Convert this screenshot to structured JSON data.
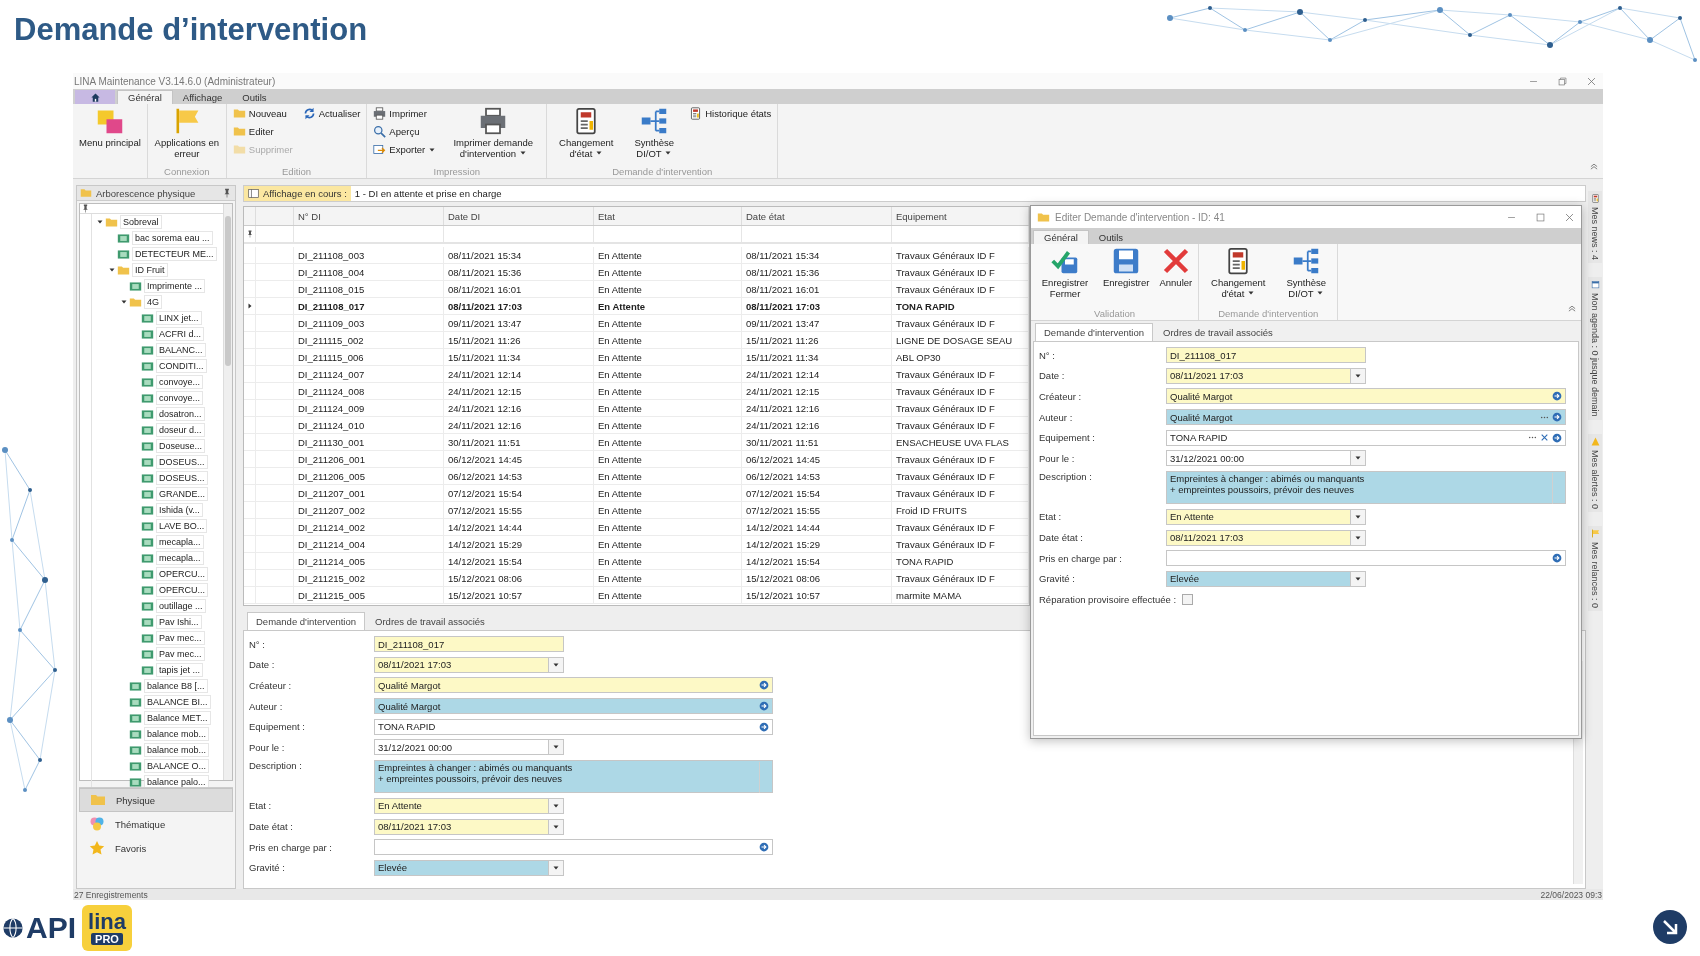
{
  "slide_title": "Demande d’intervention",
  "window": {
    "title": "LINA Maintenance V3.14.6.0 (Administrateur)"
  },
  "ribbon": {
    "tabs": [
      {
        "label": "Général",
        "selected": true
      },
      {
        "label": "Affichage",
        "selected": false
      },
      {
        "label": "Outils",
        "selected": false
      }
    ],
    "groups": [
      {
        "items": [
          {
            "label": "Menu principal",
            "kind": "large",
            "menu": false,
            "disabled": false
          }
        ]
      },
      {
        "label": "Connexion",
        "items": [
          {
            "label": "Applications en erreur",
            "kind": "large",
            "menu": false,
            "disabled": false
          }
        ]
      },
      {
        "label": "Edition",
        "items": [
          {
            "label": "Nouveau",
            "kind": "small",
            "menu": false,
            "disabled": false
          },
          {
            "label": "Editer",
            "kind": "small",
            "menu": false,
            "disabled": false
          },
          {
            "label": "Supprimer",
            "kind": "small",
            "menu": false,
            "disabled": true
          },
          {
            "label": "Actualiser",
            "kind": "small",
            "menu": false,
            "disabled": false
          }
        ]
      },
      {
        "label": "Impression",
        "items": [
          {
            "label": "Imprimer",
            "kind": "small",
            "menu": false,
            "disabled": false
          },
          {
            "label": "Aperçu",
            "kind": "small",
            "menu": false,
            "disabled": false
          },
          {
            "label": "Exporter",
            "kind": "small",
            "menu": true,
            "disabled": false
          },
          {
            "label": "Imprimer demande d'intervention",
            "kind": "large",
            "menu": true,
            "disabled": false
          }
        ]
      },
      {
        "label": "Demande d'intervention",
        "items": [
          {
            "label": "Changement d'état",
            "kind": "large",
            "menu": true,
            "disabled": false
          },
          {
            "label": "Synthèse DI/OT",
            "kind": "large",
            "menu": true,
            "disabled": false
          },
          {
            "label": "Historique états",
            "kind": "small",
            "menu": false,
            "disabled": false
          }
        ]
      }
    ]
  },
  "tree": {
    "title": "Arborescence physique",
    "items": [
      {
        "label": "Sobreval",
        "kind": "folder",
        "expanded": true,
        "children": [
          {
            "label": "bac sorema eau ...",
            "kind": "equipment"
          },
          {
            "label": "DETECTEUR ME...",
            "kind": "equipment"
          },
          {
            "label": "ID Fruit",
            "kind": "folder",
            "expanded": true,
            "children": [
              {
                "label": "Imprimente ...",
                "kind": "equipment"
              },
              {
                "label": "4G",
                "kind": "folder",
                "expanded": true,
                "children": [
                  {
                    "label": "LINX jet...",
                    "kind": "equipment"
                  },
                  {
                    "label": "ACFRI d...",
                    "kind": "equipment"
                  },
                  {
                    "label": "BALANC...",
                    "kind": "equipment"
                  },
                  {
                    "label": "CONDITI...",
                    "kind": "equipment"
                  },
                  {
                    "label": "convoye...",
                    "kind": "equipment"
                  },
                  {
                    "label": "convoye...",
                    "kind": "equipment"
                  },
                  {
                    "label": "dosatron...",
                    "kind": "equipment"
                  },
                  {
                    "label": "doseur d...",
                    "kind": "equipment"
                  },
                  {
                    "label": "Doseuse...",
                    "kind": "equipment"
                  },
                  {
                    "label": "DOSEUS...",
                    "kind": "equipment"
                  },
                  {
                    "label": "DOSEUS...",
                    "kind": "equipment"
                  },
                  {
                    "label": "GRANDE...",
                    "kind": "equipment"
                  },
                  {
                    "label": "Ishida (v...",
                    "kind": "equipment"
                  },
                  {
                    "label": "LAVE BO...",
                    "kind": "equipment"
                  },
                  {
                    "label": "mecapla...",
                    "kind": "equipment"
                  },
                  {
                    "label": "mecapla...",
                    "kind": "equipment"
                  },
                  {
                    "label": "OPERCU...",
                    "kind": "equipment"
                  },
                  {
                    "label": "OPERCU...",
                    "kind": "equipment"
                  },
                  {
                    "label": "outillage ...",
                    "kind": "equipment"
                  },
                  {
                    "label": "Pav Ishi...",
                    "kind": "equipment"
                  },
                  {
                    "label": "Pav mec...",
                    "kind": "equipment"
                  },
                  {
                    "label": "Pav mec...",
                    "kind": "equipment"
                  },
                  {
                    "label": "tapis jet ...",
                    "kind": "equipment"
                  }
                ]
              },
              {
                "label": "balance B8 [...",
                "kind": "equipment"
              },
              {
                "label": "BALANCE BI...",
                "kind": "equipment"
              },
              {
                "label": "Balance MET...",
                "kind": "equipment"
              },
              {
                "label": "balance mob...",
                "kind": "equipment"
              },
              {
                "label": "balance mob...",
                "kind": "equipment"
              },
              {
                "label": "BALANCE O...",
                "kind": "equipment"
              },
              {
                "label": "balance palo...",
                "kind": "equipment"
              }
            ]
          }
        ]
      }
    ]
  },
  "nav": [
    {
      "label": "Physique",
      "selected": true
    },
    {
      "label": "Thématique",
      "selected": false
    },
    {
      "label": "Favoris",
      "selected": false
    }
  ],
  "grid": {
    "view_label": "Affichage en cours :",
    "view_name": "1 - DI en attente et prise en charge",
    "columns": [
      "N° DI",
      "Date DI",
      "Etat",
      "Date état",
      "Equipement"
    ],
    "rows": [
      {
        "cells": [
          "DI_211108_003",
          "08/11/2021 15:34",
          "En Attente",
          "08/11/2021 15:34",
          "Travaux Généraux ID F"
        ],
        "selected": false
      },
      {
        "cells": [
          "DI_211108_004",
          "08/11/2021 15:36",
          "En Attente",
          "08/11/2021 15:36",
          "Travaux Généraux ID F"
        ],
        "selected": false
      },
      {
        "cells": [
          "DI_211108_015",
          "08/11/2021 16:01",
          "En Attente",
          "08/11/2021 16:01",
          "Travaux Généraux ID F"
        ],
        "selected": false
      },
      {
        "cells": [
          "DI_211108_017",
          "08/11/2021 17:03",
          "En Attente",
          "08/11/2021 17:03",
          "TONA RAPID"
        ],
        "selected": true
      },
      {
        "cells": [
          "DI_211109_003",
          "09/11/2021 13:47",
          "En Attente",
          "09/11/2021 13:47",
          "Travaux Généraux ID F"
        ],
        "selected": false
      },
      {
        "cells": [
          "DI_211115_002",
          "15/11/2021 11:26",
          "En Attente",
          "15/11/2021 11:26",
          "LIGNE DE DOSAGE SEAU"
        ],
        "selected": false
      },
      {
        "cells": [
          "DI_211115_006",
          "15/11/2021 11:34",
          "En Attente",
          "15/11/2021 11:34",
          "ABL OP30"
        ],
        "selected": false
      },
      {
        "cells": [
          "DI_211124_007",
          "24/11/2021 12:14",
          "En Attente",
          "24/11/2021 12:14",
          "Travaux Généraux ID F"
        ],
        "selected": false
      },
      {
        "cells": [
          "DI_211124_008",
          "24/11/2021 12:15",
          "En Attente",
          "24/11/2021 12:15",
          "Travaux Généraux ID F"
        ],
        "selected": false
      },
      {
        "cells": [
          "DI_211124_009",
          "24/11/2021 12:16",
          "En Attente",
          "24/11/2021 12:16",
          "Travaux Généraux ID F"
        ],
        "selected": false
      },
      {
        "cells": [
          "DI_211124_010",
          "24/11/2021 12:16",
          "En Attente",
          "24/11/2021 12:16",
          "Travaux Généraux ID F"
        ],
        "selected": false
      },
      {
        "cells": [
          "DI_211130_001",
          "30/11/2021 11:51",
          "En Attente",
          "30/11/2021 11:51",
          "ENSACHEUSE UVA FLAS"
        ],
        "selected": false
      },
      {
        "cells": [
          "DI_211206_001",
          "06/12/2021 14:45",
          "En Attente",
          "06/12/2021 14:45",
          "Travaux Généraux ID F"
        ],
        "selected": false
      },
      {
        "cells": [
          "DI_211206_005",
          "06/12/2021 14:53",
          "En Attente",
          "06/12/2021 14:53",
          "Travaux Généraux ID F"
        ],
        "selected": false
      },
      {
        "cells": [
          "DI_211207_001",
          "07/12/2021 15:54",
          "En Attente",
          "07/12/2021 15:54",
          "Travaux Généraux ID F"
        ],
        "selected": false
      },
      {
        "cells": [
          "DI_211207_002",
          "07/12/2021 15:55",
          "En Attente",
          "07/12/2021 15:55",
          "Froid ID FRUITS"
        ],
        "selected": false
      },
      {
        "cells": [
          "DI_211214_002",
          "14/12/2021 14:44",
          "En Attente",
          "14/12/2021 14:44",
          "Travaux Généraux ID F"
        ],
        "selected": false
      },
      {
        "cells": [
          "DI_211214_004",
          "14/12/2021 15:29",
          "En Attente",
          "14/12/2021 15:29",
          "Travaux Généraux ID F"
        ],
        "selected": false
      },
      {
        "cells": [
          "DI_211214_005",
          "14/12/2021 15:54",
          "En Attente",
          "14/12/2021 15:54",
          "TONA RAPID"
        ],
        "selected": false
      },
      {
        "cells": [
          "DI_211215_002",
          "15/12/2021 08:06",
          "En Attente",
          "15/12/2021 08:06",
          "Travaux Généraux ID F"
        ],
        "selected": false
      },
      {
        "cells": [
          "DI_211215_005",
          "15/12/2021 10:57",
          "En Attente",
          "15/12/2021 10:57",
          "marmite MAMA"
        ],
        "selected": false
      }
    ]
  },
  "detail": {
    "tabs": [
      {
        "label": "Demande d'intervention",
        "selected": true
      },
      {
        "label": "Ordres de travail associés",
        "selected": false
      }
    ],
    "fields": [
      {
        "label": "N° :",
        "kind": "text",
        "value": "DI_211108_017",
        "color": "#fdf9c6"
      },
      {
        "label": "Date :",
        "kind": "date",
        "value": "08/11/2021 17:03",
        "color": "#fdf9c6"
      },
      {
        "label": "Créateur :",
        "kind": "lookup",
        "value": "Qualité Margot",
        "color": "#fdf9c6",
        "buttons": [
          {
            "kind": "go"
          }
        ]
      },
      {
        "label": "Auteur :",
        "kind": "lookup",
        "value": "Qualité Margot",
        "color": "#add8e6",
        "buttons": [
          {
            "kind": "go"
          }
        ]
      },
      {
        "label": "Equipement :",
        "kind": "lookup",
        "value": "TONA RAPID",
        "color": "#ffffff",
        "buttons": [
          {
            "kind": "go"
          }
        ]
      },
      {
        "label": "Pour le :",
        "kind": "date",
        "value": "31/12/2021 00:00",
        "color": "#ffffff"
      },
      {
        "label": "Description :",
        "kind": "memo",
        "value": "Empreintes à changer : abimés ou manquants\n+ empreintes poussoirs, prévoir des neuves",
        "color": "#add8e6"
      },
      {
        "label": "Etat :",
        "kind": "combo",
        "value": "En Attente",
        "color": "#fdf9c6"
      },
      {
        "label": "Date état :",
        "kind": "date",
        "value": "08/11/2021 17:03",
        "color": "#fdf9c6"
      },
      {
        "label": "Pris en charge par :",
        "kind": "lookup",
        "color": "#ffffff",
        "buttons": [
          {
            "kind": "go"
          }
        ]
      },
      {
        "label": "Gravité :",
        "kind": "combo",
        "value": "Elevée",
        "color": "#add8e6"
      }
    ]
  },
  "side_tabs": [
    {
      "label": "Mes news : 4"
    },
    {
      "label": "Mon agenda : 0 jusque demain"
    },
    {
      "label": "Mes alertes : 0"
    },
    {
      "label": "Mes relances : 0"
    }
  ],
  "status_bar": {
    "left": "27 Enregistrements",
    "right": "22/06/2023 09:3"
  },
  "dialog": {
    "title": "Editer Demande d'intervention - ID: 41",
    "ribbon": {
      "tabs": [
        {
          "label": "Général",
          "selected": true
        },
        {
          "label": "Outils",
          "selected": false
        }
      ],
      "groups": [
        {
          "label": "Validation",
          "items": [
            {
              "label": "Enregistrer Fermer",
              "kind": "large",
              "menu": false,
              "disabled": false
            },
            {
              "label": "Enregistrer",
              "kind": "large",
              "menu": false,
              "disabled": false
            },
            {
              "label": "Annuler",
              "kind": "large",
              "menu": false,
              "disabled": false
            }
          ]
        },
        {
          "label": "Demande d'intervention",
          "items": [
            {
              "label": "Changement d'état",
              "kind": "large",
              "menu": true,
              "disabled": false
            },
            {
              "label": "Synthèse DI/OT",
              "kind": "large",
              "menu": true,
              "disabled": false
            }
          ]
        }
      ]
    },
    "tabs": [
      {
        "label": "Demande d'intervention",
        "selected": true
      },
      {
        "label": "Ordres de travail associés",
        "selected": false
      }
    ],
    "fields": [
      {
        "label": "N° :",
        "kind": "text",
        "value": "DI_211108_017",
        "color": "#fdf9c6"
      },
      {
        "label": "Date :",
        "kind": "date",
        "value": "08/11/2021 17:03",
        "color": "#fdf9c6"
      },
      {
        "label": "Créateur :",
        "kind": "lookup",
        "value": "Qualité Margot",
        "color": "#fdf9c6",
        "buttons": [
          {
            "kind": "go"
          }
        ]
      },
      {
        "label": "Auteur :",
        "kind": "lookup",
        "value": "Qualité Margot",
        "color": "#add8e6",
        "buttons": [
          {
            "kind": "more"
          },
          {
            "kind": "go"
          }
        ]
      },
      {
        "label": "Equipement :",
        "kind": "lookup",
        "value": "TONA RAPID",
        "color": "#ffffff",
        "buttons": [
          {
            "kind": "more"
          },
          {
            "kind": "clear"
          },
          {
            "kind": "go"
          }
        ]
      },
      {
        "label": "Pour le :",
        "kind": "date",
        "value": "31/12/2021 00:00",
        "color": "#ffffff"
      },
      {
        "label": "Description :",
        "kind": "memo",
        "value": "Empreintes à changer : abimés ou manquants\n+ empreintes poussoirs, prévoir des neuves",
        "color": "#add8e6"
      },
      {
        "label": "Etat :",
        "kind": "combo",
        "value": "En Attente",
        "color": "#fdf9c6"
      },
      {
        "label": "Date état :",
        "kind": "date",
        "value": "08/11/2021 17:03",
        "color": "#fdf9c6"
      },
      {
        "label": "Pris en charge par :",
        "kind": "lookup",
        "color": "#ffffff",
        "buttons": [
          {
            "kind": "go"
          }
        ]
      },
      {
        "label": "Gravité :",
        "kind": "combo",
        "value": "Elevée",
        "color": "#add8e6"
      },
      {
        "label": "Réparation provisoire effectuée :",
        "kind": "checkbox",
        "checked": false
      }
    ]
  },
  "logos": {
    "api": "API",
    "lina": "lina",
    "pro": "PRO"
  }
}
